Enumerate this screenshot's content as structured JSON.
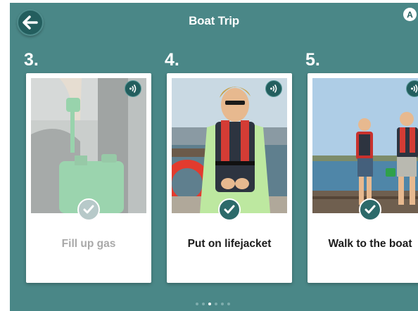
{
  "header": {
    "title": "Boat Trip",
    "back_icon": "back-arrow-icon",
    "profile_badge": "A"
  },
  "steps": [
    {
      "number": "3.",
      "label": "Fill up gas",
      "state": "completed-faded"
    },
    {
      "number": "4.",
      "label": "Put on lifejacket",
      "state": "active"
    },
    {
      "number": "5.",
      "label": "Walk to the boat",
      "state": "active"
    }
  ],
  "pagination": {
    "total": 6,
    "current": 3
  },
  "colors": {
    "background": "#4a8787",
    "button_dark": "#235e5e",
    "card": "#ffffff",
    "check_faded": "#b7c9c9"
  }
}
